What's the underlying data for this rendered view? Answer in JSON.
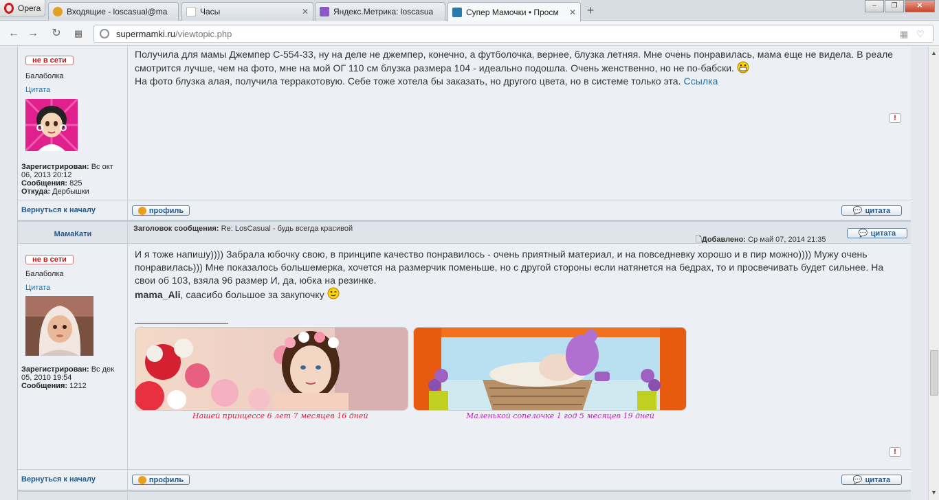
{
  "browser": {
    "menu_label": "Opera",
    "tabs": [
      {
        "title": "Входящие - loscasual@ma",
        "favicon_color": "#e0a020"
      },
      {
        "title": "Часы",
        "favicon_color": "#ffffff"
      },
      {
        "title": "Яндекс.Метрика: loscasua",
        "favicon_color": "#8a5ac8"
      },
      {
        "title": "Супер Мамочки • Просм",
        "favicon_color": "#2a7aaa"
      }
    ],
    "new_tab": "+",
    "url_host": "supermamki.ru",
    "url_path": "/viewtopic.php",
    "window_controls": [
      "–",
      "❐",
      "✕"
    ]
  },
  "posts": [
    {
      "status": "не в сети",
      "rank": "Балаболка",
      "quote_label": "Цитата",
      "registered_label": "Зарегистрирован:",
      "registered_value": "Вс окт 06, 2013 20:12",
      "messages_label": "Сообщения:",
      "messages_value": "825",
      "from_label": "Откуда:",
      "from_value": "Дербышки",
      "text1": "Получила для мамы Джемпер С-554-33, ну на деле не джемпер, конечно, а футболочка, вернее, блузка летняя. Мне очень понравилась, мама еще не видела. В реале смотрится лучше, чем на фото, мне на мой ОГ 110 см блузка размера 104 - идеально подошла. Очень женственно, но не по-бабски.",
      "text2": "На фото блузка алая, получила терракотовую. Себе тоже хотела бы заказать, но другого цвета, но в системе только эта.",
      "link": "Ссылка",
      "report": "!",
      "back_to_top": "Вернуться к началу",
      "profile_btn": "профиль",
      "quote_btn": "цитата"
    },
    {
      "author": "МамаКати",
      "subject_label": "Заголовок сообщения:",
      "subject": "Re: LosCasual - будь всегда красивой",
      "added_label": "Добавлено:",
      "added_value": "Ср май 07, 2014 21:35",
      "quote_btn_top": "цитата",
      "status": "не в сети",
      "rank": "Балаболка",
      "quote_label": "Цитата",
      "registered_label": "Зарегистрирован:",
      "registered_value": "Вс дек 05, 2010 19:54",
      "messages_label": "Сообщения:",
      "messages_value": "1212",
      "text1": "И я тоже напишу)))) Забрала юбочку свою, в принципе качество понравилось - очень приятный материал, и на повседневку хорошо и в пир можно)))) Мужу очень понравилась))) Мне показалось большемерка, хочется на размерчик поменьше, но с другой стороны если натянется на бедрах, то и просвечивать будет сильнее. На свои об 103, взяла 96 размер И, да, юбка на резинке.",
      "mention": "mama_Ali",
      "text2": ", саасибо большое за закупочку",
      "banner1_caption": "Нашей принцессе 6 лет 7 месяцев 16 дней",
      "banner2_caption": "Маленькой сопелочке 1 год 5 месяцев 19 дней",
      "report": "!",
      "back_to_top": "Вернуться к началу",
      "profile_btn": "профиль",
      "quote_btn": "цитата"
    }
  ],
  "colors": {
    "link": "#2a6fa8",
    "status_offline": "#c01818",
    "caption1": "#e0203c",
    "caption2": "#c020c0"
  }
}
